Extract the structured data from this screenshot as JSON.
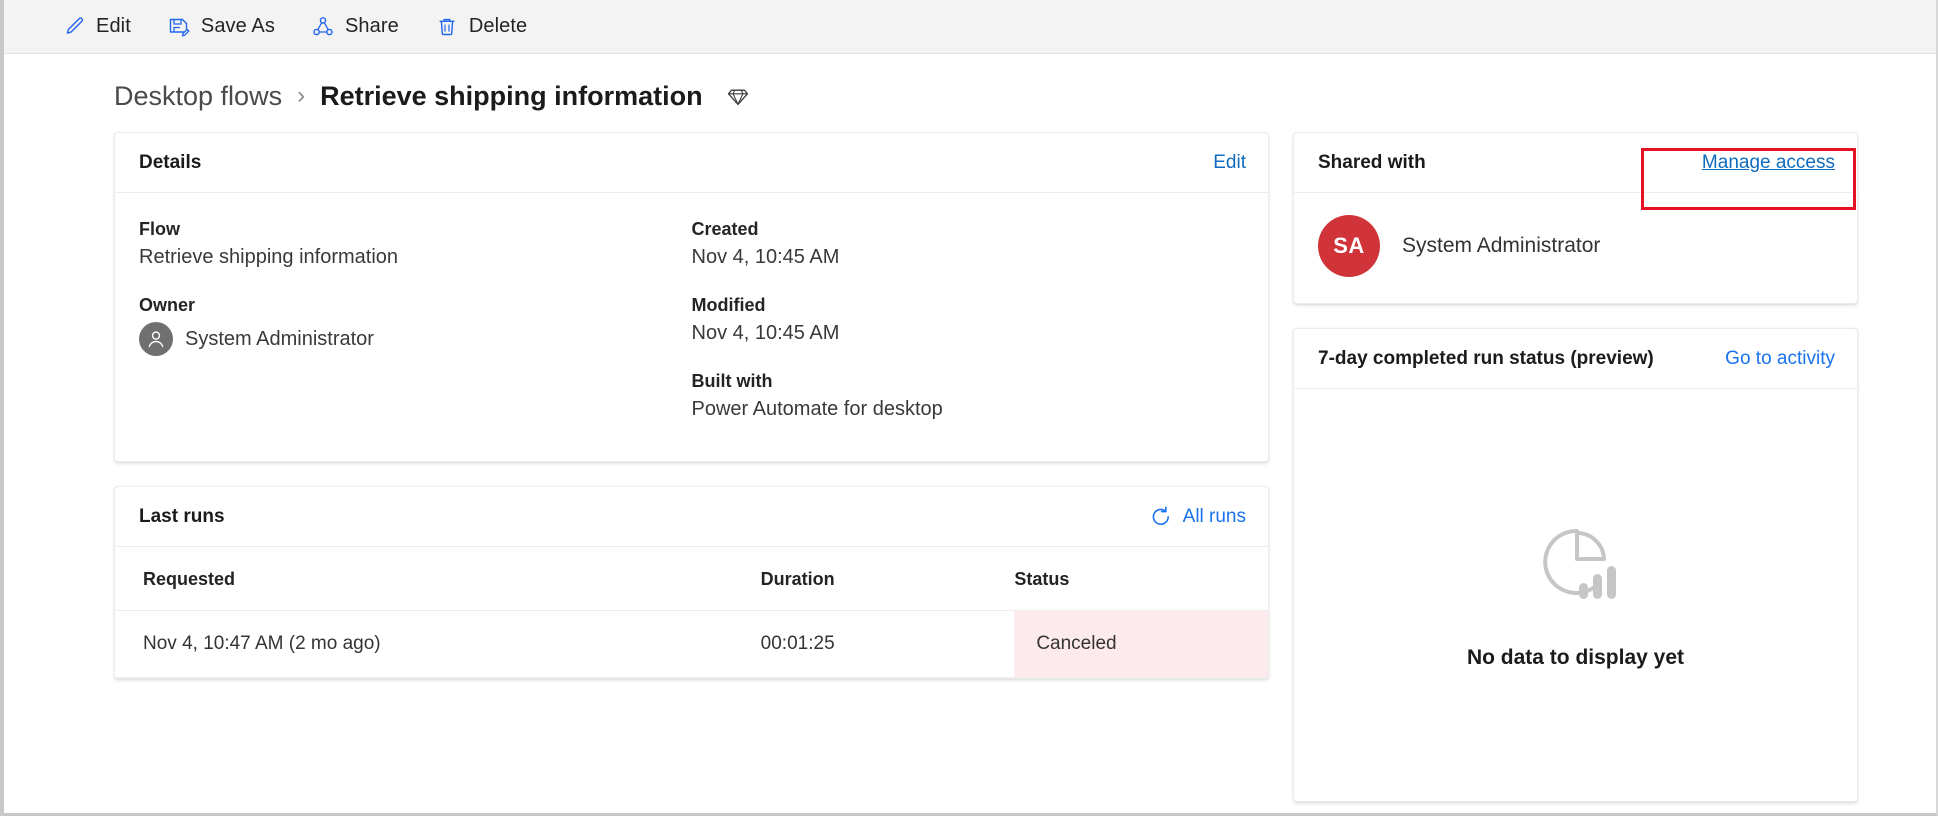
{
  "commandbar": {
    "buttons": [
      {
        "label": "Edit",
        "icon": "pencil-icon"
      },
      {
        "label": "Save As",
        "icon": "save-as-icon"
      },
      {
        "label": "Share",
        "icon": "share-icon"
      },
      {
        "label": "Delete",
        "icon": "trash-icon"
      }
    ]
  },
  "breadcrumb": {
    "parent": "Desktop flows",
    "separator": "›",
    "current": "Retrieve shipping information",
    "badge_icon": "gem-icon"
  },
  "details": {
    "title": "Details",
    "edit_label": "Edit",
    "fields": {
      "flow_label": "Flow",
      "flow_value": "Retrieve shipping information",
      "owner_label": "Owner",
      "owner_value": "System Administrator",
      "created_label": "Created",
      "created_value": "Nov 4, 10:45 AM",
      "modified_label": "Modified",
      "modified_value": "Nov 4, 10:45 AM",
      "built_with_label": "Built with",
      "built_with_value": "Power Automate for desktop"
    }
  },
  "last_runs": {
    "title": "Last runs",
    "all_runs_label": "All runs",
    "refresh_icon": "refresh-icon",
    "columns": [
      "Requested",
      "Duration",
      "Status"
    ],
    "rows": [
      {
        "requested": "Nov 4, 10:47 AM (2 mo ago)",
        "duration": "00:01:25",
        "status": "Canceled"
      }
    ],
    "status_bg": "#fdeaec"
  },
  "shared_with": {
    "title": "Shared with",
    "manage_access_label": "Manage access",
    "people": [
      {
        "initials": "SA",
        "name": "System Administrator",
        "avatar_color": "#d13438"
      }
    ]
  },
  "run_status": {
    "title": "7-day completed run status (preview)",
    "go_to_activity_label": "Go to activity",
    "empty_icon": "pie-bar-chart-icon",
    "empty_text": "No data to display yet"
  },
  "annotation": {
    "color": "#e81123",
    "target": "manage-access-link"
  }
}
